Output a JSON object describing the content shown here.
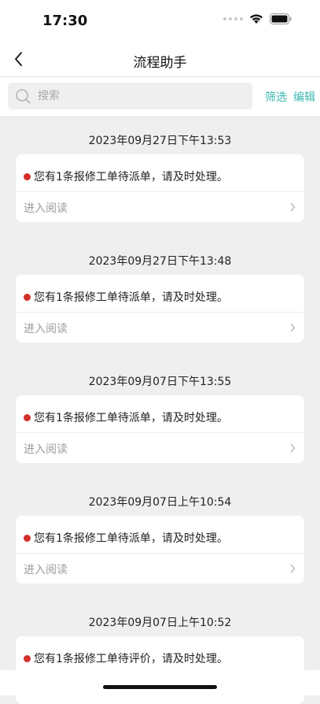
{
  "status_bar": {
    "time": "17:30",
    "icons": [
      "signal-dots-icon",
      "wifi-icon",
      "battery-icon"
    ]
  },
  "nav": {
    "title": "流程助手",
    "back_icon": "chevron-left-icon"
  },
  "search": {
    "placeholder": "搜索",
    "filter_label": "筛选",
    "edit_label": "编辑"
  },
  "messages": [
    {
      "date": "2023年09月27日下午13:53",
      "text": "您有1条报修工单待派单，请及时处理。",
      "action": "进入阅读"
    },
    {
      "date": "2023年09月27日下午13:48",
      "text": "您有1条报修工单待派单，请及时处理。",
      "action": "进入阅读"
    },
    {
      "date": "2023年09月07日下午13:55",
      "text": "您有1条报修工单待派单，请及时处理。",
      "action": "进入阅读"
    },
    {
      "date": "2023年09月07日上午10:54",
      "text": "您有1条报修工单待派单，请及时处理。",
      "action": "进入阅读"
    },
    {
      "date": "2023年09月07日上午10:52",
      "text": "您有1条报修工单待评价，请及时处理。",
      "action": ""
    }
  ],
  "colors": {
    "accent": "#3bb8b0",
    "unread_dot": "#d2302a",
    "background": "#efefef"
  }
}
